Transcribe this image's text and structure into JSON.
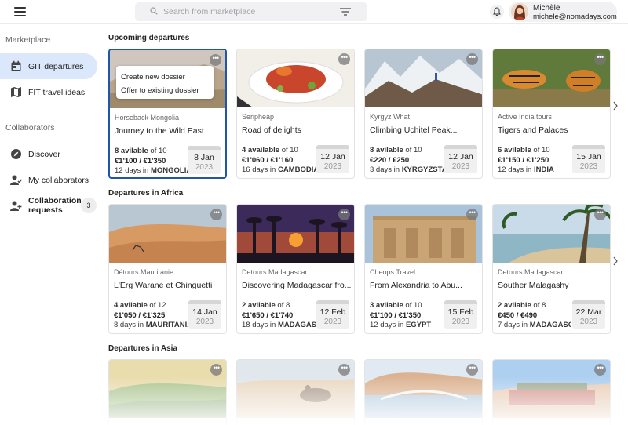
{
  "search": {
    "placeholder": "Search from marketplace"
  },
  "user": {
    "name": "Michèle",
    "email": "michele@nomadays.com"
  },
  "sidebar": {
    "marketplace_label": "Marketplace",
    "collaborators_label": "Collaborators",
    "items": [
      {
        "label": "GIT departures",
        "icon": "calendar-icon",
        "active": true
      },
      {
        "label": "FIT travel ideas",
        "icon": "map-icon"
      },
      {
        "label": "Discover",
        "icon": "compass-icon"
      },
      {
        "label": "My collaborators",
        "icon": "people-icon"
      },
      {
        "label": "Collaboration requests",
        "icon": "add-person-icon",
        "badge": "3"
      }
    ]
  },
  "popup": {
    "create": "Create new dossier",
    "offer": "Offer to existing dossier"
  },
  "sections": [
    {
      "title": "Upcoming departures",
      "cards": [
        {
          "operator": "Horseback Mongolia",
          "title": "Journey to the Wild East",
          "available": "8 avilable",
          "of": "of 10",
          "price": "€1'100 / €1'350",
          "days": "12 days",
          "country": "MONGOLIA",
          "date": "8 Jan",
          "year": "2023"
        },
        {
          "operator": "Seripheap",
          "title": "Road of delights",
          "available": "4 available",
          "of": "of 10",
          "price": "€1'060 / €1'160",
          "days": "16 days",
          "country": "CAMBODIA",
          "date": "12 Jan",
          "year": "2023"
        },
        {
          "operator": "Kyrgyz What",
          "title": "Climbing Uchitel Peak...",
          "available": "8 avilable",
          "of": "of 10",
          "price": "€220 / €250",
          "days": "3 days",
          "country": "KYRGYZSTAN",
          "date": "12 Jan",
          "year": "2023"
        },
        {
          "operator": "Active India tours",
          "title": "Tigers and Palaces",
          "available": "6 avilable",
          "of": "of 10",
          "price": "€1'150 / €1'250",
          "days": "12 days",
          "country": "INDIA",
          "date": "15 Jan",
          "year": "2023"
        }
      ]
    },
    {
      "title": "Departures in Africa",
      "cards": [
        {
          "operator": "Détours Mauritanie",
          "title": "L'Erg Warane et Chinguetti",
          "available": "4 avilable",
          "of": "of 12",
          "price": "€1'050 / €1'325",
          "days": "8 days",
          "country": "MAURITANIA",
          "date": "14 Jan",
          "year": "2023"
        },
        {
          "operator": "Detours Madagascar",
          "title": "Discovering Madagascar fro...",
          "available": "2 avilable",
          "of": "of 8",
          "price": "€1'650 / €1'740",
          "days": "18 days",
          "country": "MADAGASCAR",
          "date": "12 Feb",
          "year": "2023"
        },
        {
          "operator": "Cheops Travel",
          "title": "From Alexandria to Abu...",
          "available": "3 avilable",
          "of": "of 10",
          "price": "€1'100 / €1'350",
          "days": "12 days",
          "country": "EGYPT",
          "date": "15 Feb",
          "year": "2023"
        },
        {
          "operator": "Detours Madagascar",
          "title": "Souther Malagashy",
          "available": "2 avilable",
          "of": "of 8",
          "price": "€450 / €490",
          "days": "7 days",
          "country": "MADAGASCAR",
          "date": "22 Mar",
          "year": "2023"
        }
      ]
    },
    {
      "title": "Departures in Asia"
    }
  ],
  "in_label": "in",
  "dots_label": "•••"
}
